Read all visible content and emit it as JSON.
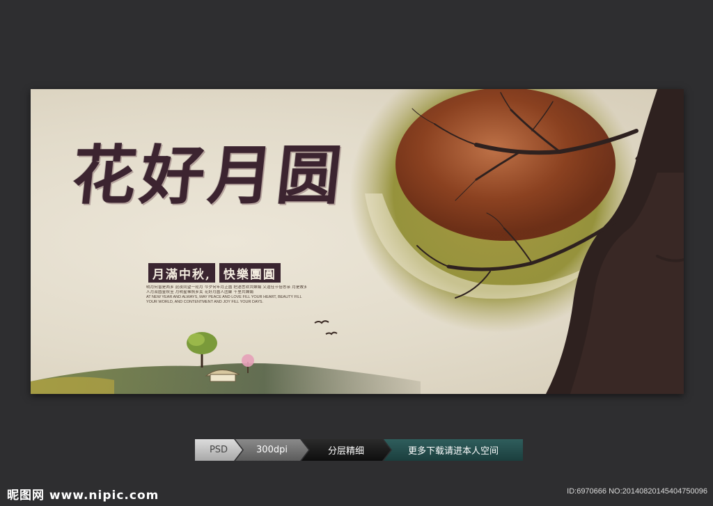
{
  "poster": {
    "title": "花好月圆",
    "banner_left": "月滿中秋,",
    "banner_right": "快樂團圓",
    "lines_zh": [
      "明月何曾是两乡 此夜同望一轮月 今夕何年月正圆 把酒言欢共婵娟 又逢佳节倍思亲 月是故乡明 举杯邀明月 但愿人长久",
      "人月双圆金秋至 月明星稀照乡关 花好月圆人团聚 千里共婵娟"
    ],
    "lines_en": [
      "AT NEW YEAR AND ALWAYS, MAY PEACE AND LOVE FILL YOUR HEART, BEAUTY FILL",
      "YOUR WORLD, AND CONTENTMENT AND JOY FILL YOUR DAYS."
    ]
  },
  "tags": {
    "format": "PSD",
    "resolution": "300dpi",
    "layers": "分层精细",
    "more": "更多下载请进本人空间"
  },
  "footer": {
    "logo": "昵图网 www.nipic.com",
    "id_text": "ID:6970666 NO:20140820145404750096"
  },
  "colors": {
    "background": "#2e2e30",
    "parchment": "#e2dbca",
    "calligraphy": "#3c2430",
    "banner": "#3a2530",
    "sun_outer": "#8a8a2a",
    "sun_inner": "#7a3a1c",
    "more_tag": "#2f5e5c"
  }
}
